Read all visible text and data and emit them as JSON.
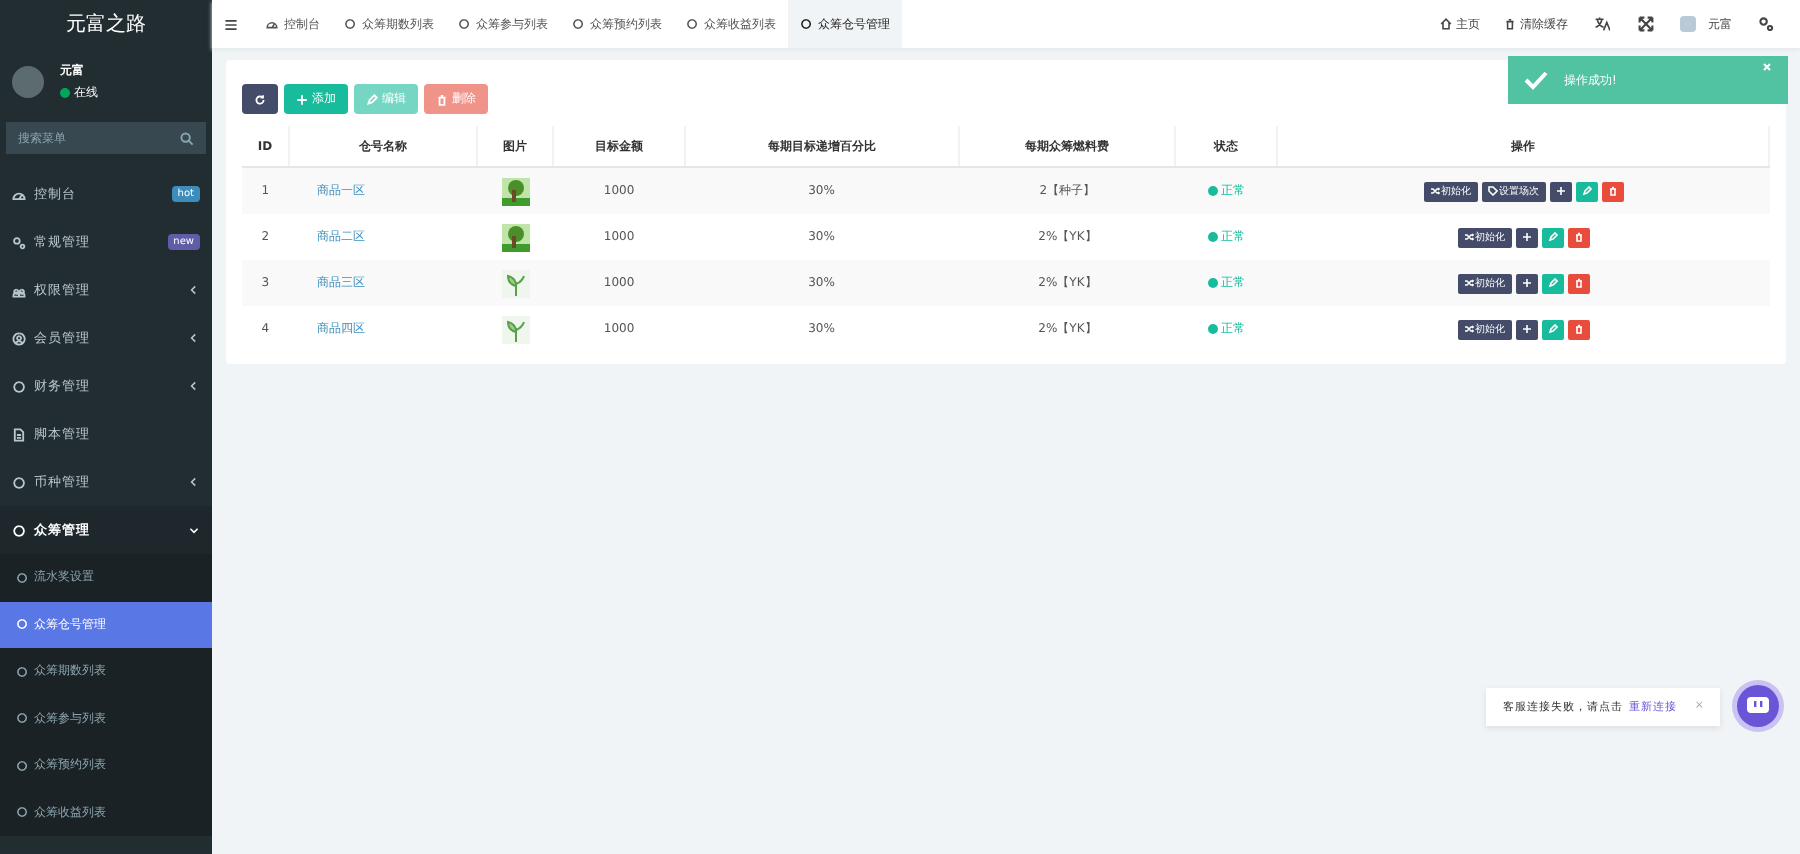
{
  "sidebar": {
    "logo": "元富之路",
    "user": {
      "name": "元富",
      "status": "在线"
    },
    "search": {
      "placeholder": "搜索菜单"
    },
    "items": [
      {
        "label": "控制台",
        "badge": "hot",
        "color": "#3c8dbc",
        "has_arrow": false,
        "expanded": false,
        "selected": false
      },
      {
        "label": "常规管理",
        "badge": "new",
        "color": "#605ca8",
        "has_arrow": false,
        "expanded": false,
        "selected": false
      },
      {
        "label": "权限管理",
        "has_arrow": true,
        "expanded": false,
        "selected": false
      },
      {
        "label": "会员管理",
        "has_arrow": true,
        "expanded": false,
        "selected": false
      },
      {
        "label": "财务管理",
        "has_arrow": true,
        "expanded": false,
        "selected": false
      },
      {
        "label": "脚本管理",
        "has_arrow": false,
        "expanded": false,
        "selected": false
      },
      {
        "label": "币种管理",
        "has_arrow": true,
        "expanded": false,
        "selected": false
      },
      {
        "label": "众筹管理",
        "has_arrow": true,
        "expanded": true,
        "selected": false,
        "children": [
          {
            "label": "流水奖设置",
            "selected": false
          },
          {
            "label": "众筹仓号管理",
            "selected": true
          },
          {
            "label": "众筹期数列表",
            "selected": false
          },
          {
            "label": "众筹参与列表",
            "selected": false
          },
          {
            "label": "众筹预约列表",
            "selected": false
          },
          {
            "label": "众筹收益列表",
            "selected": false
          }
        ]
      }
    ]
  },
  "tabs": [
    {
      "label": "控制台",
      "selected": false
    },
    {
      "label": "众筹期数列表",
      "selected": false
    },
    {
      "label": "众筹参与列表",
      "selected": false
    },
    {
      "label": "众筹预约列表",
      "selected": false
    },
    {
      "label": "众筹收益列表",
      "selected": false
    },
    {
      "label": "众筹仓号管理",
      "selected": true
    }
  ],
  "header_right": {
    "home": "主页",
    "clear_cache": "清除缓存",
    "user": "元富"
  },
  "toolbar": [
    {
      "kind": "refresh",
      "disabled": false
    },
    {
      "kind": "add",
      "label": "添加",
      "disabled": false
    },
    {
      "kind": "edit",
      "label": "编辑",
      "disabled": true
    },
    {
      "kind": "delete",
      "label": "删除",
      "disabled": true
    }
  ],
  "table": {
    "columns": [
      "ID",
      "仓号名称",
      "图片",
      "目标金额",
      "每期目标递增百分比",
      "每期众筹燃料费",
      "状态",
      "操作"
    ],
    "rows": [
      {
        "id": "1",
        "name": "商品一区",
        "kind": "tree",
        "target": "1000",
        "increase": "30%",
        "fee": "2【种子】",
        "status": "正常",
        "actions": [
          {
            "kind": "init",
            "label": "初始化"
          },
          {
            "kind": "session",
            "label": "设置场次"
          },
          {
            "kind": "plus"
          },
          {
            "kind": "edit"
          },
          {
            "kind": "delete"
          }
        ]
      },
      {
        "id": "2",
        "name": "商品二区",
        "kind": "tree",
        "target": "1000",
        "increase": "30%",
        "fee": "2%【YK】",
        "status": "正常",
        "actions": [
          {
            "kind": "init",
            "label": "初始化"
          },
          {
            "kind": "plus"
          },
          {
            "kind": "edit"
          },
          {
            "kind": "delete"
          }
        ]
      },
      {
        "id": "3",
        "name": "商品三区",
        "kind": "sprout",
        "target": "1000",
        "increase": "30%",
        "fee": "2%【YK】",
        "status": "正常",
        "actions": [
          {
            "kind": "init",
            "label": "初始化"
          },
          {
            "kind": "plus"
          },
          {
            "kind": "edit"
          },
          {
            "kind": "delete"
          }
        ]
      },
      {
        "id": "4",
        "name": "商品四区",
        "kind": "sprout",
        "target": "1000",
        "increase": "30%",
        "fee": "2%【YK】",
        "status": "正常",
        "actions": [
          {
            "kind": "init",
            "label": "初始化"
          },
          {
            "kind": "plus"
          },
          {
            "kind": "edit"
          },
          {
            "kind": "delete"
          }
        ]
      }
    ]
  },
  "toast": {
    "message": "操作成功!"
  },
  "chat": {
    "message": "客服连接失败，请点击",
    "link": "重新连接",
    "close": "×"
  }
}
